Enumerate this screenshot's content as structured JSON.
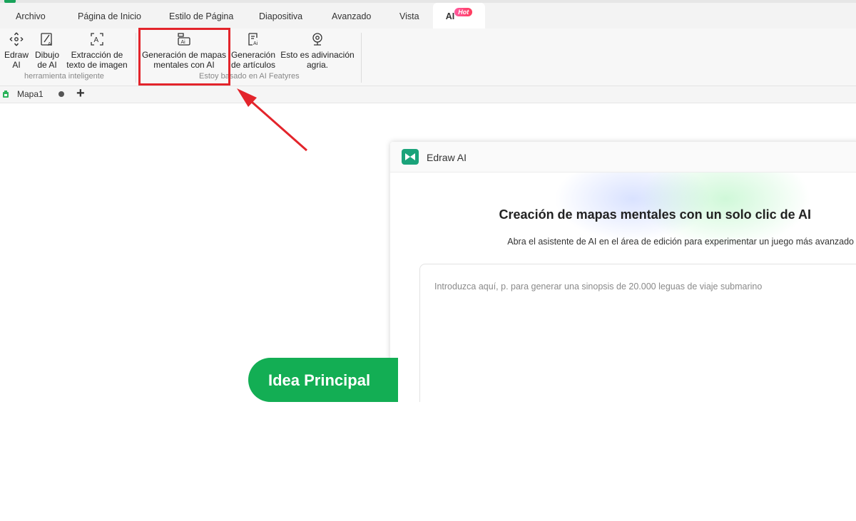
{
  "menu": {
    "tabs": [
      "Archivo",
      "Página de Inicio",
      "Estilo de Página",
      "Diapositiva",
      "Avanzado",
      "Vista"
    ],
    "ai_tab": {
      "label": "AI",
      "badge": "Hot"
    }
  },
  "ribbon": {
    "group1": {
      "label": "herramienta inteligente",
      "edraw_ai": "Edraw\nAI",
      "dibujo_ai": "Dibujo\nde AI",
      "extraccion": "Extracción de\ntexto de imagen"
    },
    "group2": {
      "label": "Estoy basado en AI Featyres",
      "mindmap": "Generación de mapas\nmentales con AI",
      "articulos": "Generación\nde artículos",
      "adivinacion": "Esto es adivinación\nagria."
    }
  },
  "doc_tabs": {
    "current": "Mapa1",
    "add_label": "+"
  },
  "panel": {
    "title": "Edraw AI",
    "heading": "Creación de mapas mentales con un solo clic de AI",
    "subtitle": "Abra el asistente de AI en el área de edición para experimentar un juego más avanzado",
    "input_placeholder": "Introduzca aquí, p. para generar una sinopsis de 20.000 leguas de viaje submarino"
  },
  "canvas": {
    "central_topic": "Idea Principal"
  },
  "colors": {
    "highlight": "#e3242b",
    "brand_green": "#13ae54",
    "hot_badge": "#ff3b5c"
  }
}
